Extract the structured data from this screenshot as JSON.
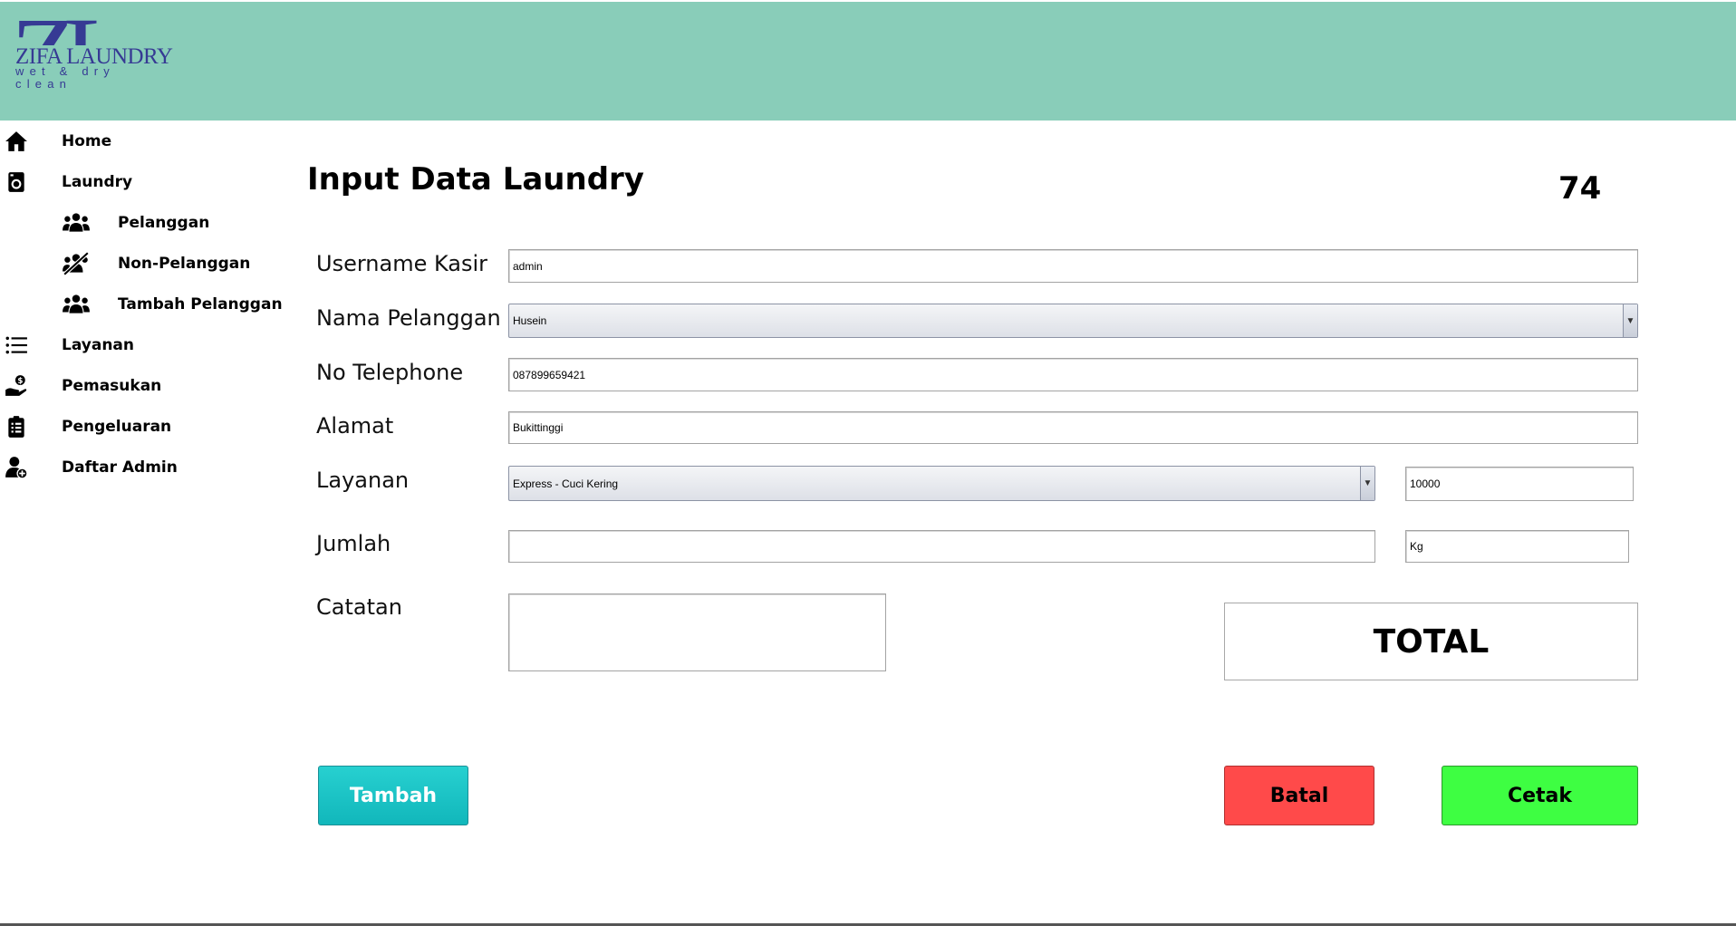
{
  "app": {
    "logo_text": "ZL",
    "logo_name": "ZIFA LAUNDRY",
    "logo_tagline": "wet & dry clean"
  },
  "sidebar": {
    "items": [
      {
        "label": "Home",
        "icon": "home-icon"
      },
      {
        "label": "Laundry",
        "icon": "washing-machine-icon"
      },
      {
        "label": "Pelanggan",
        "icon": "users-icon"
      },
      {
        "label": "Non-Pelanggan",
        "icon": "users-slash-icon"
      },
      {
        "label": "Tambah Pelanggan",
        "icon": "users-icon"
      },
      {
        "label": "Layanan",
        "icon": "list-icon"
      },
      {
        "label": "Pemasukan",
        "icon": "hand-dollar-icon"
      },
      {
        "label": "Pengeluaran",
        "icon": "clipboard-list-icon"
      },
      {
        "label": "Daftar Admin",
        "icon": "user-plus-icon"
      }
    ]
  },
  "main": {
    "title": "Input Data Laundry",
    "record_number": "74",
    "form": {
      "username_label": "Username Kasir",
      "username_value": "admin",
      "nama_label": "Nama Pelanggan",
      "nama_value": "Husein",
      "telp_label": "No Telephone",
      "telp_value": "087899659421",
      "alamat_label": "Alamat",
      "alamat_value": "Bukittinggi",
      "layanan_label": "Layanan",
      "layanan_value": "Express - Cuci Kering",
      "harga_value": "10000",
      "jumlah_label": "Jumlah",
      "jumlah_value": "",
      "satuan_value": "Kg",
      "catatan_label": "Catatan",
      "catatan_value": ""
    },
    "total_label": "TOTAL",
    "buttons": {
      "tambah": "Tambah",
      "batal": "Batal",
      "cetak": "Cetak"
    }
  },
  "colors": {
    "header": "#89cdb9",
    "logo": "#363a94",
    "tambah_button": "#11b7bb",
    "batal_button": "#ff4a4a",
    "cetak_button": "#3efe42"
  }
}
